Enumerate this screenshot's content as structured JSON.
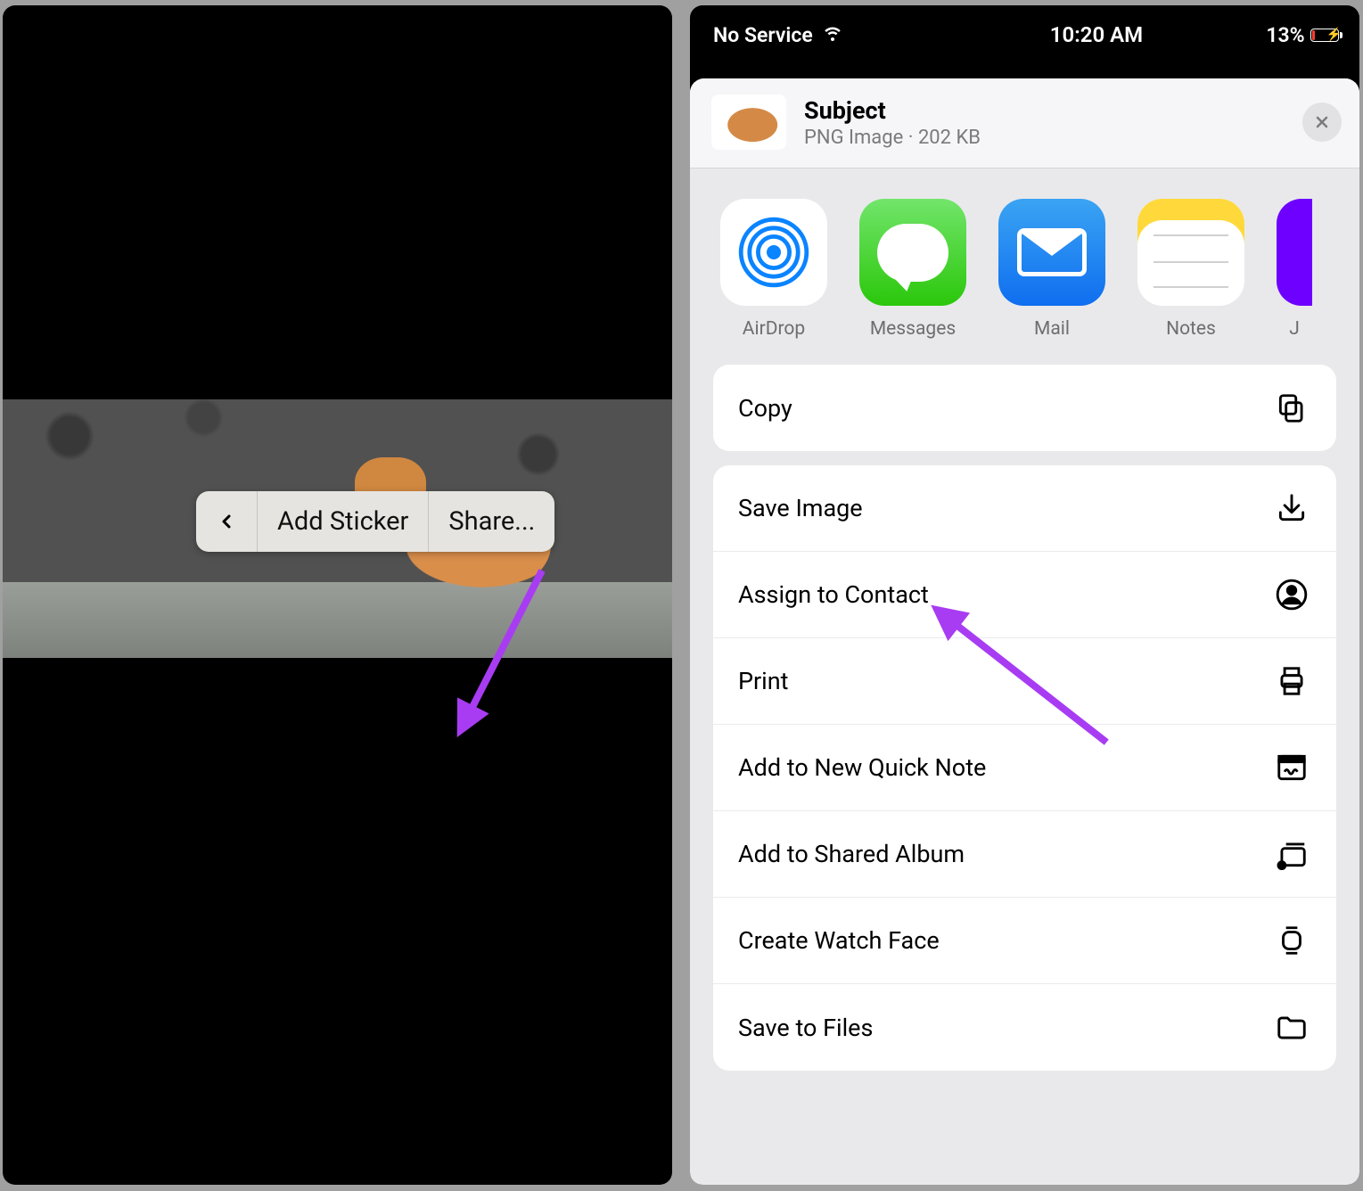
{
  "left": {
    "context_menu": {
      "back_icon": "‹",
      "add_sticker": "Add Sticker",
      "share": "Share..."
    }
  },
  "right": {
    "status": {
      "carrier": "No Service",
      "time": "10:20 AM",
      "battery_pct": "13%"
    },
    "sheet": {
      "title": "Subject",
      "subtitle": "PNG Image · 202 KB"
    },
    "apps": [
      {
        "label": "AirDrop"
      },
      {
        "label": "Messages"
      },
      {
        "label": "Mail"
      },
      {
        "label": "Notes"
      },
      {
        "label": "J"
      }
    ],
    "group1": [
      {
        "label": "Copy",
        "icon": "copy"
      }
    ],
    "group2": [
      {
        "label": "Save Image",
        "icon": "download"
      },
      {
        "label": "Assign to Contact",
        "icon": "contact"
      },
      {
        "label": "Print",
        "icon": "printer"
      },
      {
        "label": "Add to New Quick Note",
        "icon": "quicknote"
      },
      {
        "label": "Add to Shared Album",
        "icon": "sharedalbum"
      },
      {
        "label": "Create Watch Face",
        "icon": "watch"
      },
      {
        "label": "Save to Files",
        "icon": "folder"
      }
    ]
  }
}
